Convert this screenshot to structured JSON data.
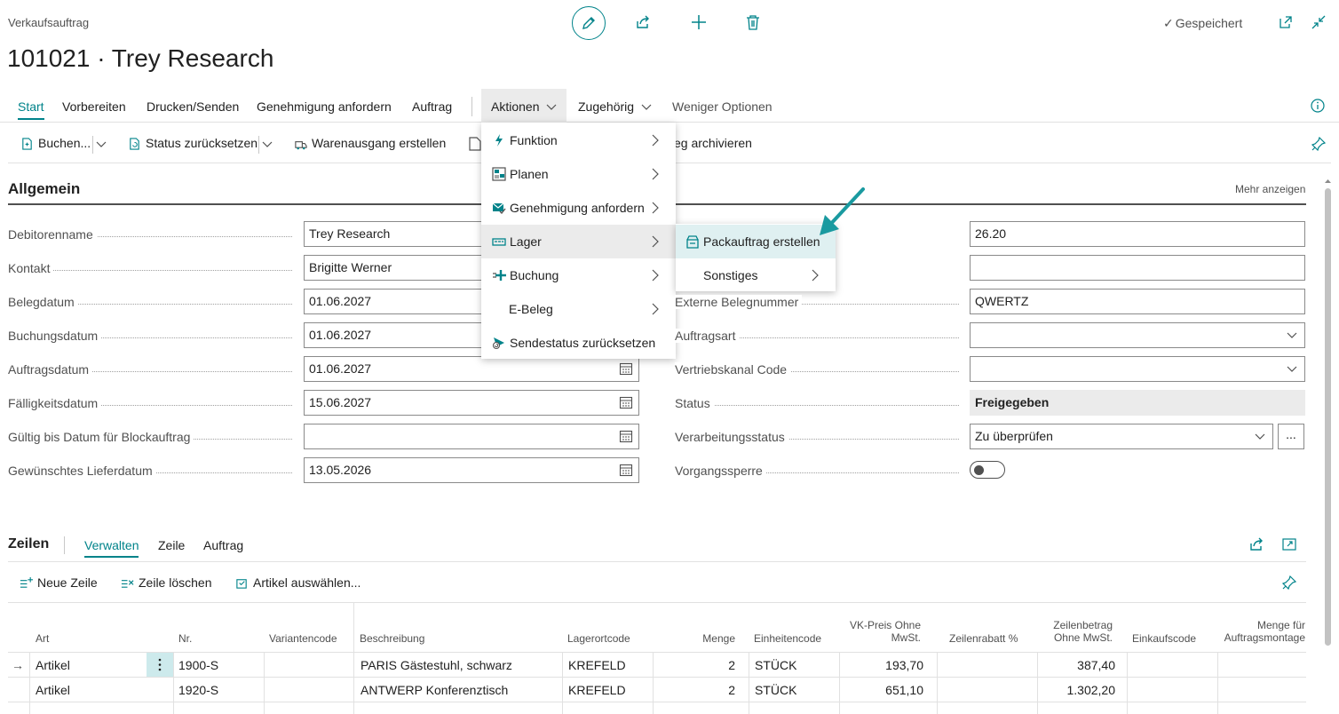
{
  "header": {
    "page_type": "Verkaufsauftrag",
    "title": "101021 · Trey Research",
    "saved_label": "Gespeichert"
  },
  "tabs": {
    "start": "Start",
    "vorbereiten": "Vorbereiten",
    "drucken": "Drucken/Senden",
    "genehmigung": "Genehmigung anfordern",
    "auftrag": "Auftrag",
    "aktionen": "Aktionen",
    "zugehoerig": "Zugehörig",
    "weniger": "Weniger Optionen"
  },
  "actions": {
    "buchen": "Buchen...",
    "status": "Status zurücksetzen",
    "warenausgang": "Warenausgang erstellen",
    "archivieren": "eg archivieren"
  },
  "section": {
    "title": "Allgemein",
    "more": "Mehr anzeigen"
  },
  "left_fields": [
    {
      "label": "Debitorenname",
      "value": "Trey Research"
    },
    {
      "label": "Kontakt",
      "value": "Brigitte Werner"
    },
    {
      "label": "Belegdatum",
      "value": "01.06.2027"
    },
    {
      "label": "Buchungsdatum",
      "value": "01.06.2027"
    },
    {
      "label": "Auftragsdatum",
      "value": "01.06.2027"
    },
    {
      "label": "Fälligkeitsdatum",
      "value": "15.06.2027"
    },
    {
      "label": "Gültig bis Datum für Blockauftrag",
      "value": ""
    },
    {
      "label": "Gewünschtes Lieferdatum",
      "value": "13.05.2026"
    }
  ],
  "right_fields": [
    {
      "label": "",
      "value": "26.20"
    },
    {
      "label": "",
      "value": ""
    },
    {
      "label": "Externe Belegnummer",
      "value": "QWERTZ"
    },
    {
      "label": "Auftragsart",
      "value": ""
    },
    {
      "label": "Vertriebskanal Code",
      "value": ""
    },
    {
      "label": "Status",
      "value": "Freigegeben"
    },
    {
      "label": "Verarbeitungsstatus",
      "value": "Zu überprüfen"
    },
    {
      "label": "Vorgangssperre",
      "value": ""
    }
  ],
  "ellipsis": "...",
  "menu": {
    "items": [
      {
        "label": "Funktion",
        "icon": "lightning-icon"
      },
      {
        "label": "Planen",
        "icon": "plan-icon"
      },
      {
        "label": "Genehmigung anfordern",
        "icon": "approval-icon"
      },
      {
        "label": "Lager",
        "icon": "warehouse-icon"
      },
      {
        "label": "Buchung",
        "icon": "post-icon"
      },
      {
        "label": "E-Beleg",
        "icon": ""
      },
      {
        "label": "Sendestatus zurücksetzen",
        "icon": "reset-send-icon"
      }
    ],
    "submenu": [
      {
        "label": "Packauftrag erstellen",
        "icon": "pack-icon"
      },
      {
        "label": "Sonstiges",
        "icon": ""
      }
    ]
  },
  "lines": {
    "title": "Zeilen",
    "tabs": [
      "Verwalten",
      "Zeile",
      "Auftrag"
    ],
    "actions": {
      "new": "Neue Zeile",
      "delete": "Zeile löschen",
      "select": "Artikel auswählen..."
    },
    "headers": {
      "art": "Art",
      "nr": "Nr.",
      "variant": "Variantencode",
      "desc": "Beschreibung",
      "lagerort": "Lagerortcode",
      "menge": "Menge",
      "einheit": "Einheitencode",
      "vkpreis1": "VK-Preis Ohne",
      "vkpreis2": "MwSt.",
      "rabatt": "Zeilenrabatt %",
      "betrag1": "Zeilenbetrag",
      "betrag2": "Ohne MwSt.",
      "einkauf": "Einkaufscode",
      "montage1": "Menge für",
      "montage2": "Auftragsmontage"
    },
    "rows": [
      {
        "arrow": "→",
        "art": "Artikel",
        "nr": "1900-S",
        "variant": "",
        "desc": "PARIS Gästestuhl, schwarz",
        "lagerort": "KREFELD",
        "menge": "2",
        "einheit": "STÜCK",
        "preis": "193,70",
        "rabatt": "",
        "betrag": "387,40"
      },
      {
        "arrow": "",
        "art": "Artikel",
        "nr": "1920-S",
        "variant": "",
        "desc": "ANTWERP Konferenztisch",
        "lagerort": "KREFELD",
        "menge": "2",
        "einheit": "STÜCK",
        "preis": "651,10",
        "rabatt": "",
        "betrag": "1.302,20"
      }
    ]
  }
}
